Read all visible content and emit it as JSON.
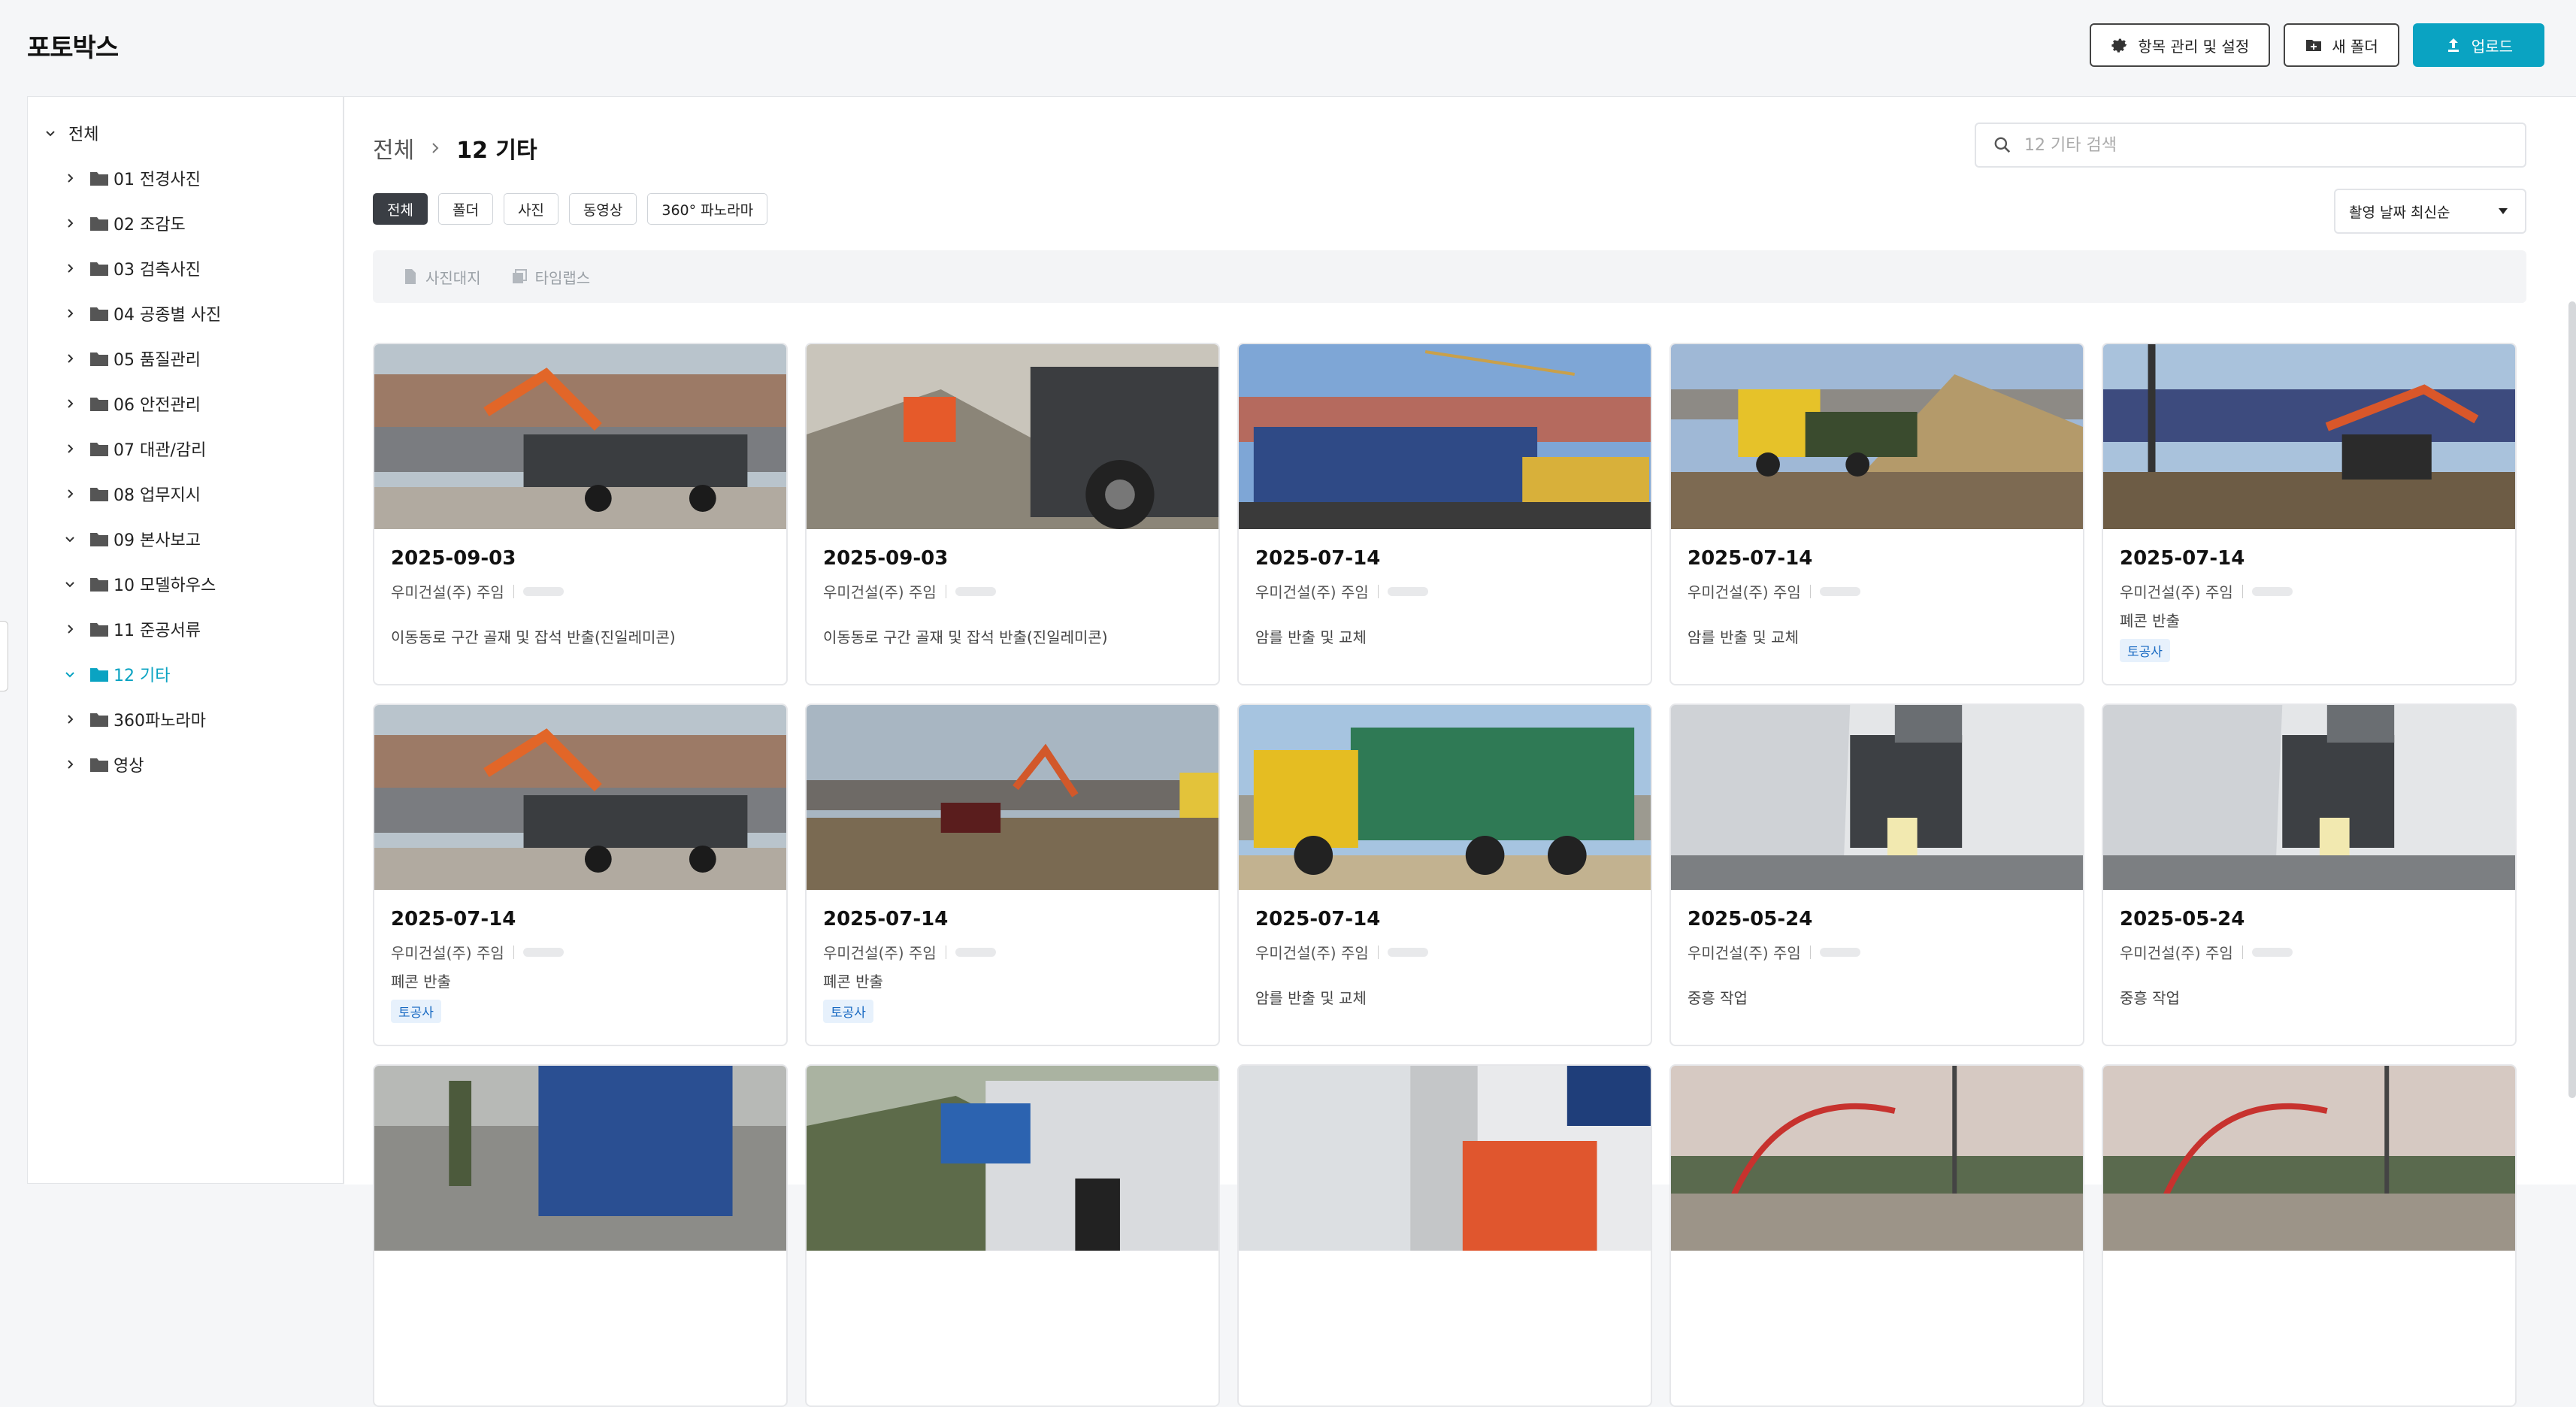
{
  "app": {
    "title": "포토박스"
  },
  "top_actions": {
    "settings_label": "항목 관리 및 설정",
    "new_folder_label": "새 폴더",
    "upload_label": "업로드"
  },
  "sidebar": {
    "root_label": "전체",
    "items": [
      {
        "label": "01 전경사진",
        "expanded": false,
        "active": false
      },
      {
        "label": "02 조감도",
        "expanded": false,
        "active": false
      },
      {
        "label": "03 검측사진",
        "expanded": false,
        "active": false
      },
      {
        "label": "04 공종별 사진",
        "expanded": false,
        "active": false
      },
      {
        "label": "05 품질관리",
        "expanded": false,
        "active": false
      },
      {
        "label": "06 안전관리",
        "expanded": false,
        "active": false
      },
      {
        "label": "07 대관/감리",
        "expanded": false,
        "active": false
      },
      {
        "label": "08 업무지시",
        "expanded": false,
        "active": false
      },
      {
        "label": "09 본사보고",
        "expanded": true,
        "active": false
      },
      {
        "label": "10 모델하우스",
        "expanded": true,
        "active": false
      },
      {
        "label": "11 준공서류",
        "expanded": false,
        "active": false
      },
      {
        "label": "12 기타",
        "expanded": true,
        "active": true
      },
      {
        "label": "360파노라마",
        "expanded": false,
        "active": false
      },
      {
        "label": "영상",
        "expanded": false,
        "active": false
      }
    ]
  },
  "breadcrumb": {
    "root": "전체",
    "current": "12 기타"
  },
  "search": {
    "placeholder": "12 기타 검색"
  },
  "filters": [
    {
      "label": "전체",
      "active": true
    },
    {
      "label": "폴더",
      "active": false
    },
    {
      "label": "사진",
      "active": false
    },
    {
      "label": "동영상",
      "active": false
    },
    {
      "label": "360° 파노라마",
      "active": false
    }
  ],
  "sort": {
    "selected": "촬영 날짜 최신순"
  },
  "toolbar": {
    "photo_sheet_label": "사진대지",
    "timelapse_label": "타임랩스"
  },
  "colors": {
    "accent": "#0aa3c2",
    "active_chip": "#3a3e44",
    "tag_text": "#1769c2",
    "tag_bg": "#e7f1fc"
  },
  "cards": [
    {
      "date": "2025-09-03",
      "author": "우미건설(주) 주임",
      "desc": "이동동로 구간 골재 및 잡석 반출(진일레미콘)",
      "tag": "",
      "scene": "excavator-truck"
    },
    {
      "date": "2025-09-03",
      "author": "우미건설(주) 주임",
      "desc": "이동동로 구간 골재 및 잡석 반출(진일레미콘)",
      "tag": "",
      "scene": "gravel-truck"
    },
    {
      "date": "2025-07-14",
      "author": "우미건설(주) 주임",
      "desc": "암를 반출 및 교체",
      "tag": "",
      "scene": "crane-tarp"
    },
    {
      "date": "2025-07-14",
      "author": "우미건설(주) 주임",
      "desc": "암를 반출 및 교체",
      "tag": "",
      "scene": "yellow-truck"
    },
    {
      "date": "2025-07-14",
      "author": "우미건설(주) 주임",
      "desc": "폐콘 반출",
      "tag": "토공사",
      "scene": "pile-rig"
    },
    {
      "date": "2025-07-14",
      "author": "우미건설(주) 주임",
      "desc": "폐콘 반출",
      "tag": "토공사",
      "scene": "excavator-truck"
    },
    {
      "date": "2025-07-14",
      "author": "우미건설(주) 주임",
      "desc": "폐콘 반출",
      "tag": "토공사",
      "scene": "site-excavator"
    },
    {
      "date": "2025-07-14",
      "author": "우미건설(주) 주임",
      "desc": "암를 반출 및 교체",
      "tag": "",
      "scene": "green-dump"
    },
    {
      "date": "2025-05-24",
      "author": "우미건설(주) 주임",
      "desc": "중흥 작업",
      "tag": "",
      "scene": "gray-truck"
    },
    {
      "date": "2025-05-24",
      "author": "우미건설(주) 주임",
      "desc": "중흥 작업",
      "tag": "",
      "scene": "gray-truck"
    },
    {
      "date": "",
      "author": "",
      "desc": "",
      "tag": "",
      "scene": "blue-crane"
    },
    {
      "date": "",
      "author": "",
      "desc": "",
      "tag": "",
      "scene": "kato-crane"
    },
    {
      "date": "",
      "author": "",
      "desc": "",
      "tag": "",
      "scene": "orange-wall"
    },
    {
      "date": "",
      "author": "",
      "desc": "",
      "tag": "",
      "scene": "pump-red"
    },
    {
      "date": "",
      "author": "",
      "desc": "",
      "tag": "",
      "scene": "pump-red"
    }
  ]
}
